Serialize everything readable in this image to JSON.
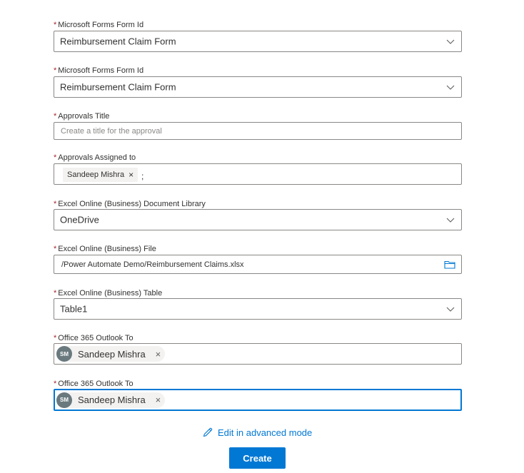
{
  "required_marker": "*",
  "fields": {
    "form_id_1": {
      "label": "Microsoft Forms Form Id",
      "value": "Reimbursement Claim Form"
    },
    "form_id_2": {
      "label": "Microsoft Forms Form Id",
      "value": "Reimbursement Claim Form"
    },
    "approvals_title": {
      "label": "Approvals Title",
      "placeholder": "Create a title for the approval"
    },
    "approvals_assigned": {
      "label": "Approvals Assigned to",
      "tag": "Sandeep Mishra",
      "tag_remove": "×",
      "separator": ";"
    },
    "doc_library": {
      "label": "Excel Online (Business) Document Library",
      "value": "OneDrive"
    },
    "file": {
      "label": "Excel Online (Business) File",
      "value": "/Power Automate Demo/Reimbursement Claims.xlsx"
    },
    "table": {
      "label": "Excel Online (Business) Table",
      "value": "Table1"
    },
    "outlook_to_1": {
      "label": "Office 365 Outlook To",
      "initials": "SM",
      "name": "Sandeep Mishra",
      "remove": "×"
    },
    "outlook_to_2": {
      "label": "Office 365 Outlook To",
      "initials": "SM",
      "name": "Sandeep Mishra",
      "remove": "×"
    }
  },
  "advanced_link": "Edit in advanced mode",
  "create_button": "Create",
  "colors": {
    "accent": "#0078d4",
    "required": "#a4262c",
    "avatar": "#69797e",
    "border": "#8a8886"
  },
  "icons": {
    "dropdown": "chevron-down-icon",
    "file_picker": "folder-icon",
    "advanced": "pencil-icon"
  }
}
